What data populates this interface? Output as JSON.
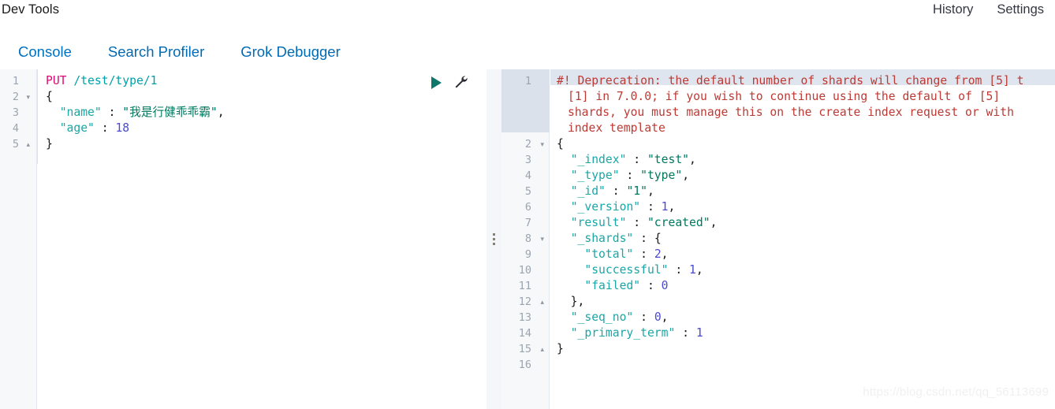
{
  "header": {
    "title": "Dev Tools",
    "links": [
      {
        "label": "History",
        "name": "history-link"
      },
      {
        "label": "Settings",
        "name": "settings-link"
      }
    ]
  },
  "tabs": [
    {
      "label": "Console",
      "active": true
    },
    {
      "label": "Search Profiler",
      "active": false
    },
    {
      "label": "Grok Debugger",
      "active": false
    }
  ],
  "colors": {
    "accent": "#0071c2",
    "link": "#006bb4",
    "method": "#dd0a73",
    "url": "#00a0a7",
    "key": "#1ba6a6",
    "string": "#00785f",
    "number": "#4a4ad0",
    "warning": "#bd3a34",
    "play": "#0f766a",
    "active_line": "#dce3ec"
  },
  "request_editor": {
    "method": "PUT",
    "path": "/test/type/1",
    "line_numbers": [
      "1",
      "2",
      "3",
      "4",
      "5"
    ],
    "fold_markers": {
      "2": "▾",
      "5": "▴"
    },
    "lines": [
      {
        "n": "1",
        "type": "request",
        "text": "PUT /test/type/1"
      },
      {
        "n": "2",
        "type": "brace",
        "text": "{"
      },
      {
        "n": "3",
        "type": "pair",
        "key": "\"name\"",
        "colon": " : ",
        "value": "\"我是行健乖乖霸\"",
        "value_kind": "string",
        "trail": ","
      },
      {
        "n": "4",
        "type": "pair",
        "key": "\"age\"",
        "colon": " : ",
        "value": "18",
        "value_kind": "number",
        "trail": ""
      },
      {
        "n": "5",
        "type": "brace",
        "text": "}"
      }
    ],
    "actions": [
      {
        "name": "run-request-button",
        "icon": "play-icon",
        "label": ""
      },
      {
        "name": "request-options-button",
        "icon": "wrench-icon",
        "label": ""
      }
    ]
  },
  "response_editor": {
    "line_numbers": [
      "1",
      "2",
      "3",
      "4",
      "5",
      "6",
      "7",
      "8",
      "9",
      "10",
      "11",
      "12",
      "13",
      "14",
      "15",
      "16"
    ],
    "fold_markers": {
      "2": "▾",
      "8": "▾",
      "12": "▴",
      "15": "▴"
    },
    "deprecation": [
      "#! Deprecation: the default number of shards will change from [5] t",
      "[1] in 7.0.0; if you wish to continue using the default of [5]",
      "shards, you must manage this on the create index request or with",
      "index template"
    ],
    "lines": [
      {
        "n": "2",
        "indent": 0,
        "type": "brace",
        "text": "{"
      },
      {
        "n": "3",
        "indent": 1,
        "type": "pair",
        "key": "\"_index\"",
        "colon": " : ",
        "value": "\"test\"",
        "value_kind": "string",
        "trail": ","
      },
      {
        "n": "4",
        "indent": 1,
        "type": "pair",
        "key": "\"_type\"",
        "colon": " : ",
        "value": "\"type\"",
        "value_kind": "string",
        "trail": ","
      },
      {
        "n": "5",
        "indent": 1,
        "type": "pair",
        "key": "\"_id\"",
        "colon": " : ",
        "value": "\"1\"",
        "value_kind": "string",
        "trail": ","
      },
      {
        "n": "6",
        "indent": 1,
        "type": "pair",
        "key": "\"_version\"",
        "colon": " : ",
        "value": "1",
        "value_kind": "number",
        "trail": ","
      },
      {
        "n": "7",
        "indent": 1,
        "type": "pair",
        "key": "\"result\"",
        "colon": " : ",
        "value": "\"created\"",
        "value_kind": "string",
        "trail": ","
      },
      {
        "n": "8",
        "indent": 1,
        "type": "pair",
        "key": "\"_shards\"",
        "colon": " : ",
        "value": "{",
        "value_kind": "brace",
        "trail": ""
      },
      {
        "n": "9",
        "indent": 2,
        "type": "pair",
        "key": "\"total\"",
        "colon": " : ",
        "value": "2",
        "value_kind": "number",
        "trail": ","
      },
      {
        "n": "10",
        "indent": 2,
        "type": "pair",
        "key": "\"successful\"",
        "colon": " : ",
        "value": "1",
        "value_kind": "number",
        "trail": ","
      },
      {
        "n": "11",
        "indent": 2,
        "type": "pair",
        "key": "\"failed\"",
        "colon": " : ",
        "value": "0",
        "value_kind": "number",
        "trail": ""
      },
      {
        "n": "12",
        "indent": 1,
        "type": "brace",
        "text": "},"
      },
      {
        "n": "13",
        "indent": 1,
        "type": "pair",
        "key": "\"_seq_no\"",
        "colon": " : ",
        "value": "0",
        "value_kind": "number",
        "trail": ","
      },
      {
        "n": "14",
        "indent": 1,
        "type": "pair",
        "key": "\"_primary_term\"",
        "colon": " : ",
        "value": "1",
        "value_kind": "number",
        "trail": ""
      },
      {
        "n": "15",
        "indent": 0,
        "type": "brace",
        "text": "}"
      },
      {
        "n": "16",
        "indent": 0,
        "type": "blank",
        "text": ""
      }
    ]
  },
  "watermark": "https://blog.csdn.net/qq_56113699"
}
